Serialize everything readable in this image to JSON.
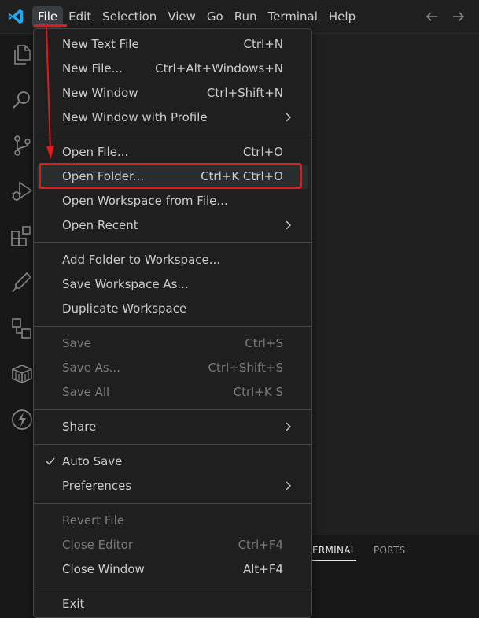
{
  "menubar": {
    "items": [
      "File",
      "Edit",
      "Selection",
      "View",
      "Go",
      "Run",
      "Terminal",
      "Help"
    ]
  },
  "activitybar": {
    "icons": [
      "explorer-icon",
      "search-icon",
      "source-control-icon",
      "run-debug-icon",
      "extensions-icon",
      "testing-icon",
      "remote-explorer-icon",
      "containers-icon",
      "thunder-client-icon"
    ]
  },
  "panel": {
    "tabs": [
      "ERMINAL",
      "PORTS"
    ]
  },
  "file_menu": {
    "group1": [
      {
        "label": "New Text File",
        "shortcut": "Ctrl+N"
      },
      {
        "label": "New File...",
        "shortcut": "Ctrl+Alt+Windows+N"
      },
      {
        "label": "New Window",
        "shortcut": "Ctrl+Shift+N"
      },
      {
        "label": "New Window with Profile",
        "shortcut": ""
      }
    ],
    "group2": [
      {
        "label": "Open File...",
        "shortcut": "Ctrl+O"
      },
      {
        "label": "Open Folder...",
        "shortcut": "Ctrl+K Ctrl+O"
      },
      {
        "label": "Open Workspace from File...",
        "shortcut": ""
      },
      {
        "label": "Open Recent",
        "shortcut": ""
      }
    ],
    "group3": [
      {
        "label": "Add Folder to Workspace...",
        "shortcut": ""
      },
      {
        "label": "Save Workspace As...",
        "shortcut": ""
      },
      {
        "label": "Duplicate Workspace",
        "shortcut": ""
      }
    ],
    "group4": [
      {
        "label": "Save",
        "shortcut": "Ctrl+S"
      },
      {
        "label": "Save As...",
        "shortcut": "Ctrl+Shift+S"
      },
      {
        "label": "Save All",
        "shortcut": "Ctrl+K S"
      }
    ],
    "group5": [
      {
        "label": "Share",
        "shortcut": ""
      }
    ],
    "group6": [
      {
        "label": "Auto Save",
        "shortcut": ""
      },
      {
        "label": "Preferences",
        "shortcut": ""
      }
    ],
    "group7": [
      {
        "label": "Revert File",
        "shortcut": ""
      },
      {
        "label": "Close Editor",
        "shortcut": "Ctrl+F4"
      },
      {
        "label": "Close Window",
        "shortcut": "Alt+F4"
      }
    ],
    "group8": [
      {
        "label": "Exit",
        "shortcut": ""
      }
    ]
  },
  "colors": {
    "annotation_red": "#e01b1b",
    "vscode_blue": "#23a9f2"
  }
}
